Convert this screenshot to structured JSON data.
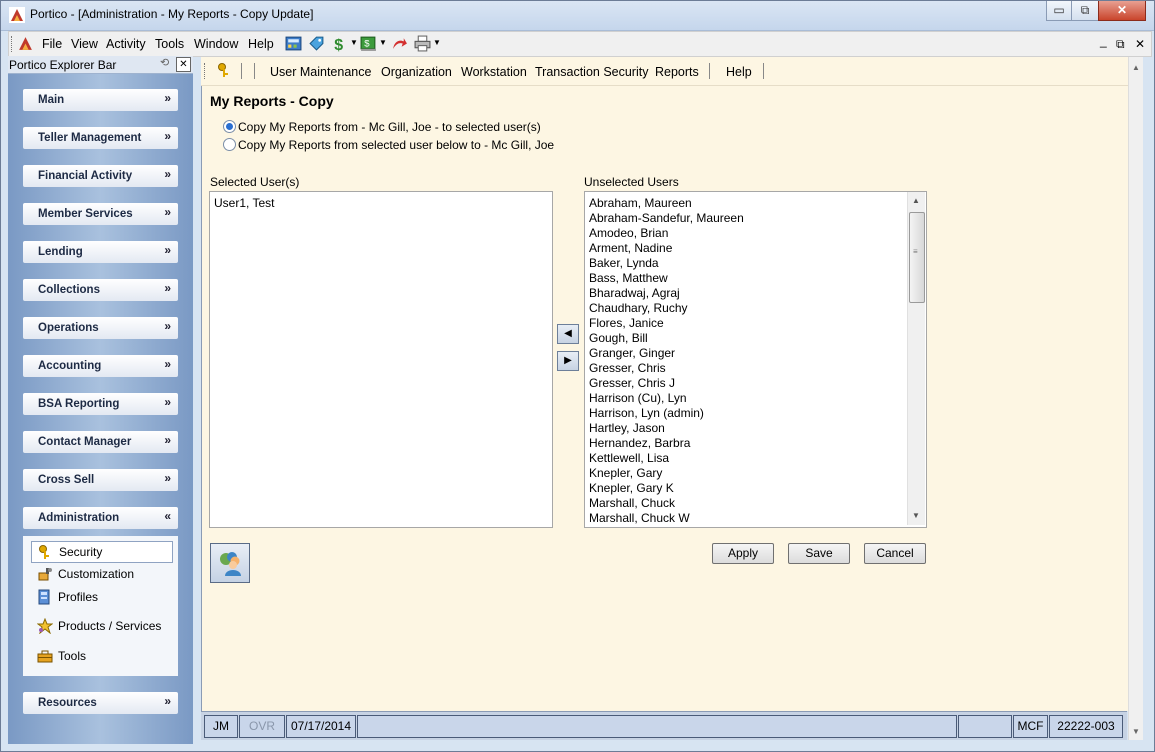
{
  "window": {
    "title": "Portico - [Administration - My Reports - Copy Update]",
    "controls": {
      "minimize": "▭",
      "restore": "⧉",
      "close": "✕"
    }
  },
  "menu": {
    "items": [
      "File",
      "View",
      "Activity",
      "Tools",
      "Window",
      "Help"
    ],
    "mdi_controls": {
      "minimize": "_",
      "restore": "⧉",
      "close": "✕"
    }
  },
  "explorer": {
    "title": "Portico Explorer Bar",
    "panels": [
      {
        "label": "Main",
        "chevron": "»"
      },
      {
        "label": "Teller Management",
        "chevron": "»"
      },
      {
        "label": "Financial Activity",
        "chevron": "»"
      },
      {
        "label": "Member Services",
        "chevron": "»"
      },
      {
        "label": "Lending",
        "chevron": "»"
      },
      {
        "label": "Collections",
        "chevron": "»"
      },
      {
        "label": "Operations",
        "chevron": "»"
      },
      {
        "label": "Accounting",
        "chevron": "»"
      },
      {
        "label": "BSA Reporting",
        "chevron": "»"
      },
      {
        "label": "Contact Manager",
        "chevron": "»"
      },
      {
        "label": "Cross Sell",
        "chevron": "»"
      },
      {
        "label": "Administration",
        "chevron": "«"
      },
      {
        "label": "Resources",
        "chevron": "»"
      }
    ],
    "admin_items": [
      {
        "label": "Security",
        "selected": true,
        "icon": "keys-icon"
      },
      {
        "label": "Customization",
        "icon": "paint-icon"
      },
      {
        "label": "Profiles",
        "icon": "profiles-icon"
      },
      {
        "label": "Products / Services",
        "icon": "products-icon"
      },
      {
        "label": "Tools",
        "icon": "toolbox-icon"
      }
    ]
  },
  "nav": {
    "items": [
      "User Maintenance",
      "Organization",
      "Workstation",
      "Transaction Security",
      "Reports",
      "Help"
    ]
  },
  "page": {
    "title": "My Reports - Copy",
    "option1": "Copy My Reports from - Mc Gill, Joe - to selected user(s)",
    "option2": "Copy My Reports from selected user below to - Mc Gill, Joe",
    "option1_selected": true,
    "selected_label": "Selected User(s)",
    "unselected_label": "Unselected Users",
    "selected_users": [
      "User1, Test"
    ],
    "unselected_users": [
      "Abraham, Maureen",
      "Abraham-Sandefur, Maureen",
      "Amodeo, Brian",
      "Arment, Nadine",
      "Baker, Lynda",
      "Bass, Matthew",
      "Bharadwaj, Agraj",
      "Chaudhary, Ruchy",
      "Flores, Janice",
      "Gough, Bill",
      "Granger, Ginger",
      "Gresser, Chris",
      "Gresser, Chris J",
      "Harrison (Cu), Lyn",
      "Harrison, Lyn (admin)",
      "Hartley, Jason",
      "Hernandez, Barbra",
      "Kettlewell, Lisa",
      "Knepler, Gary",
      "Knepler, Gary K",
      "Marshall, Chuck",
      "Marshall, Chuck W"
    ],
    "move_left": "◀",
    "move_right": "▶",
    "buttons": {
      "apply": "Apply",
      "save": "Save",
      "cancel": "Cancel"
    }
  },
  "status": {
    "user": "JM",
    "ovr": "OVR",
    "date": "07/17/2014",
    "mode": "MCF",
    "account": "22222-003"
  }
}
